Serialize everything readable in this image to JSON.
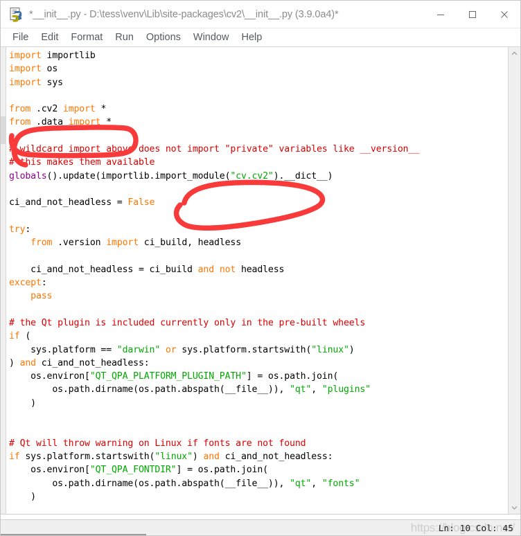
{
  "window": {
    "title": "*__init__.py - D:\\tess\\venv\\Lib\\site-packages\\cv2\\__init__.py (3.9.0a4)*",
    "app_icon": "python-idle-icon",
    "controls": {
      "minimize": "minimize-icon",
      "maximize": "maximize-icon",
      "close": "close-icon"
    }
  },
  "menubar": {
    "items": [
      {
        "label": "File"
      },
      {
        "label": "Edit"
      },
      {
        "label": "Format"
      },
      {
        "label": "Run"
      },
      {
        "label": "Options"
      },
      {
        "label": "Window"
      },
      {
        "label": "Help"
      }
    ]
  },
  "editor": {
    "language": "python",
    "colors": {
      "keyword": "#ff7700",
      "comment": "#dd0000",
      "string": "#00aa00",
      "builtin": "#900090",
      "definition": "#0000ff",
      "plain": "#000000",
      "background": "#ffffff",
      "annotation": "#f83a3a"
    },
    "lines": [
      [
        {
          "t": "import",
          "c": "kw"
        },
        {
          "t": " importlib",
          "c": "pl"
        }
      ],
      [
        {
          "t": "import",
          "c": "kw"
        },
        {
          "t": " os",
          "c": "pl"
        }
      ],
      [
        {
          "t": "import",
          "c": "kw"
        },
        {
          "t": " sys",
          "c": "pl"
        }
      ],
      [],
      [
        {
          "t": "from",
          "c": "kw"
        },
        {
          "t": " .cv2 ",
          "c": "pl"
        },
        {
          "t": "import",
          "c": "kw"
        },
        {
          "t": " *",
          "c": "pl"
        }
      ],
      [
        {
          "t": "from",
          "c": "kw"
        },
        {
          "t": " .data ",
          "c": "pl"
        },
        {
          "t": "import",
          "c": "kw"
        },
        {
          "t": " *",
          "c": "pl"
        }
      ],
      [],
      [
        {
          "t": "# wildcard import above does not import \"private\" variables like __version__",
          "c": "cmt"
        }
      ],
      [
        {
          "t": "# this makes them available",
          "c": "cmt"
        }
      ],
      [
        {
          "t": "globals",
          "c": "bi"
        },
        {
          "t": "().update(importlib.import_module(",
          "c": "pl"
        },
        {
          "t": "\"cv.cv2\"",
          "c": "str"
        },
        {
          "t": ").__dict__)",
          "c": "pl"
        }
      ],
      [],
      [
        {
          "t": "ci_and_not_headless = ",
          "c": "pl"
        },
        {
          "t": "False",
          "c": "kw"
        }
      ],
      [],
      [
        {
          "t": "try",
          "c": "kw"
        },
        {
          "t": ":",
          "c": "pl"
        }
      ],
      [
        {
          "t": "    ",
          "c": "pl"
        },
        {
          "t": "from",
          "c": "kw"
        },
        {
          "t": " .version ",
          "c": "pl"
        },
        {
          "t": "import",
          "c": "kw"
        },
        {
          "t": " ci_build, headless",
          "c": "pl"
        }
      ],
      [],
      [
        {
          "t": "    ci_and_not_headless = ci_build ",
          "c": "pl"
        },
        {
          "t": "and",
          "c": "kw"
        },
        {
          "t": " ",
          "c": "pl"
        },
        {
          "t": "not",
          "c": "kw"
        },
        {
          "t": " headless",
          "c": "pl"
        }
      ],
      [
        {
          "t": "except",
          "c": "kw"
        },
        {
          "t": ":",
          "c": "pl"
        }
      ],
      [
        {
          "t": "    ",
          "c": "pl"
        },
        {
          "t": "pass",
          "c": "kw"
        }
      ],
      [],
      [
        {
          "t": "# the Qt plugin is included currently only in the pre-built wheels",
          "c": "cmt"
        }
      ],
      [
        {
          "t": "if",
          "c": "kw"
        },
        {
          "t": " (",
          "c": "pl"
        }
      ],
      [
        {
          "t": "    sys.platform == ",
          "c": "pl"
        },
        {
          "t": "\"darwin\"",
          "c": "str"
        },
        {
          "t": " ",
          "c": "pl"
        },
        {
          "t": "or",
          "c": "kw"
        },
        {
          "t": " sys.platform.startswith(",
          "c": "pl"
        },
        {
          "t": "\"linux\"",
          "c": "str"
        },
        {
          "t": ")",
          "c": "pl"
        }
      ],
      [
        {
          "t": ") ",
          "c": "pl"
        },
        {
          "t": "and",
          "c": "kw"
        },
        {
          "t": " ci_and_not_headless:",
          "c": "pl"
        }
      ],
      [
        {
          "t": "    os.environ[",
          "c": "pl"
        },
        {
          "t": "\"QT_QPA_PLATFORM_PLUGIN_PATH\"",
          "c": "str"
        },
        {
          "t": "] = os.path.join(",
          "c": "pl"
        }
      ],
      [
        {
          "t": "        os.path.dirname(os.path.abspath(__file__)), ",
          "c": "pl"
        },
        {
          "t": "\"qt\"",
          "c": "str"
        },
        {
          "t": ", ",
          "c": "pl"
        },
        {
          "t": "\"plugins\"",
          "c": "str"
        }
      ],
      [
        {
          "t": "    )",
          "c": "pl"
        }
      ],
      [],
      [],
      [
        {
          "t": "# Qt will throw warning on Linux if fonts are not found",
          "c": "cmt"
        }
      ],
      [
        {
          "t": "if",
          "c": "kw"
        },
        {
          "t": " sys.platform.startswith(",
          "c": "pl"
        },
        {
          "t": "\"linux\"",
          "c": "str"
        },
        {
          "t": ") ",
          "c": "pl"
        },
        {
          "t": "and",
          "c": "kw"
        },
        {
          "t": " ci_and_not_headless:",
          "c": "pl"
        }
      ],
      [
        {
          "t": "    os.environ[",
          "c": "pl"
        },
        {
          "t": "\"QT_QPA_FONTDIR\"",
          "c": "str"
        },
        {
          "t": "] = os.path.join(",
          "c": "pl"
        }
      ],
      [
        {
          "t": "        os.path.dirname(os.path.abspath(__file__)), ",
          "c": "pl"
        },
        {
          "t": "\"qt\"",
          "c": "str"
        },
        {
          "t": ", ",
          "c": "pl"
        },
        {
          "t": "\"fonts\"",
          "c": "str"
        }
      ],
      [
        {
          "t": "    )",
          "c": "pl"
        }
      ]
    ],
    "annotations": [
      {
        "name": "annotation-circle-cv2-import",
        "shape": "hand-drawn-rounded-rect"
      },
      {
        "name": "annotation-circle-import-module",
        "shape": "hand-drawn-oval"
      }
    ]
  },
  "scrollbars": {
    "vertical": {
      "up_arrow": "chevron-up-icon",
      "down_arrow": "chevron-down-icon"
    },
    "horizontal": {
      "present": true
    }
  },
  "statusbar": {
    "position": "Ln: 10  Col: 45",
    "watermark": "https://blog.csdn.net/"
  }
}
